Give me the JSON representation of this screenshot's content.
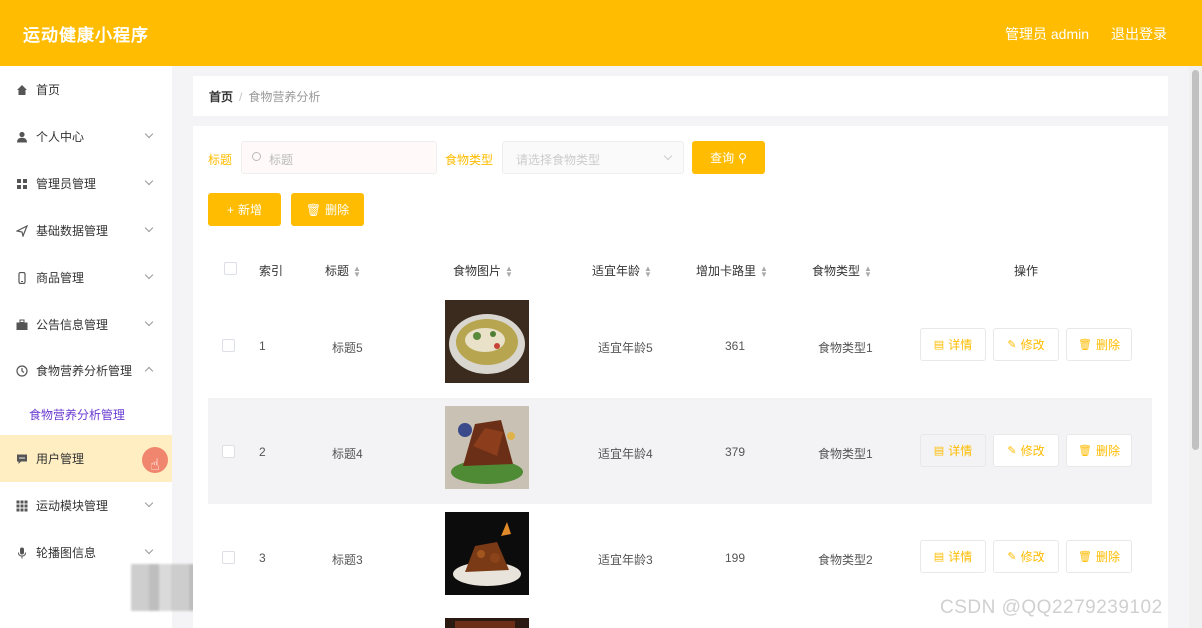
{
  "header": {
    "app_title": "运动健康小程序",
    "user_label": "管理员 admin",
    "logout_label": "退出登录"
  },
  "sidebar": {
    "items": [
      {
        "label": "首页",
        "icon": "home-icon"
      },
      {
        "label": "个人中心",
        "icon": "person-icon"
      },
      {
        "label": "管理员管理",
        "icon": "grid-icon"
      },
      {
        "label": "基础数据管理",
        "icon": "send-icon"
      },
      {
        "label": "商品管理",
        "icon": "phone-icon"
      },
      {
        "label": "公告信息管理",
        "icon": "briefcase-icon"
      },
      {
        "label": "食物营养分析管理",
        "icon": "clock-icon"
      },
      {
        "label": "用户管理",
        "icon": "chat-icon"
      },
      {
        "label": "运动模块管理",
        "icon": "apps-icon"
      },
      {
        "label": "轮播图信息",
        "icon": "mic-icon"
      }
    ],
    "submenu_label": "食物营养分析管理"
  },
  "breadcrumb": {
    "home": "首页",
    "separator": "/",
    "current": "食物营养分析"
  },
  "filters": {
    "title_label": "标题",
    "title_placeholder": "标题",
    "type_label": "食物类型",
    "type_placeholder": "请选择食物类型",
    "search_label": "查询"
  },
  "actions": {
    "add_label": "新增",
    "delete_label": "删除"
  },
  "table": {
    "columns": {
      "index": "索引",
      "title": "标题",
      "image": "食物图片",
      "age": "适宜年龄",
      "calories": "增加卡路里",
      "type": "食物类型",
      "ops": "操作"
    },
    "rows": [
      {
        "index": "1",
        "title": "标题5",
        "age": "适宜年龄5",
        "calories": "361",
        "type": "食物类型1"
      },
      {
        "index": "2",
        "title": "标题4",
        "age": "适宜年龄4",
        "calories": "379",
        "type": "食物类型1"
      },
      {
        "index": "3",
        "title": "标题3",
        "age": "适宜年龄3",
        "calories": "199",
        "type": "食物类型2"
      }
    ],
    "op_labels": {
      "detail": "详情",
      "edit": "修改",
      "delete": "删除"
    }
  },
  "watermark": "CSDN @QQ2279239102",
  "colors": {
    "accent": "#ffbc00",
    "active_menu_bg": "#ffeec2",
    "submenu_text": "#6a3bd2"
  }
}
